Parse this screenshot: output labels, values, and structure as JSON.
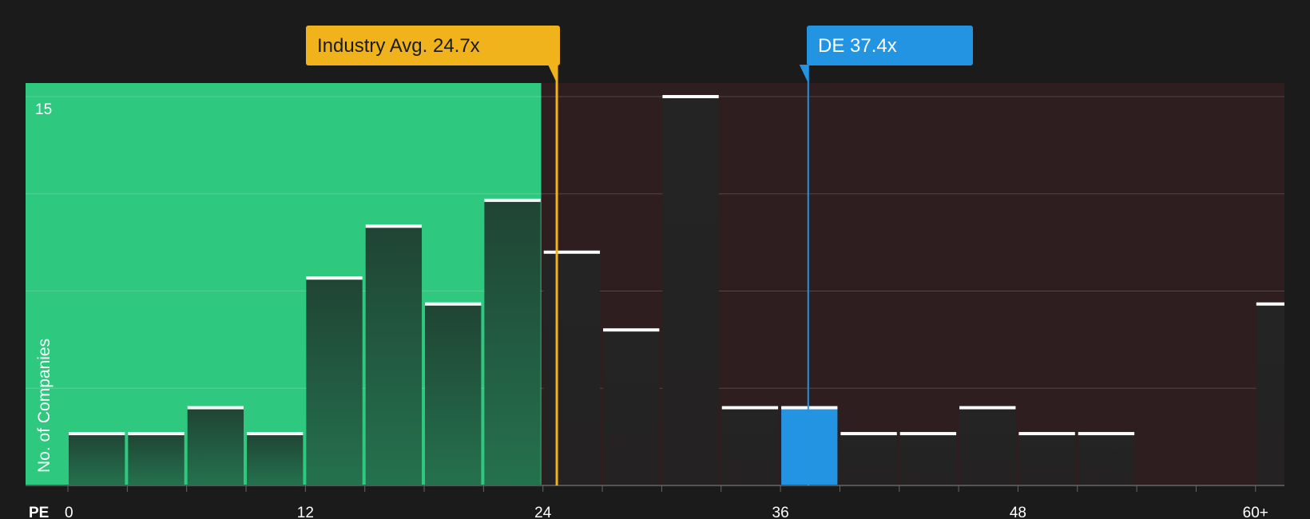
{
  "chart_data": {
    "type": "bar",
    "x_axis_label": "PE",
    "y_axis_label": "No. of Companies",
    "y_tick_label": "15",
    "x_ticks": [
      "0",
      "12",
      "24",
      "36",
      "48",
      "60+"
    ],
    "bin_width": 3,
    "ylim": [
      0,
      15
    ],
    "bars": [
      {
        "x_start": 0,
        "value": 2,
        "region": "below"
      },
      {
        "x_start": 3,
        "value": 2,
        "region": "below"
      },
      {
        "x_start": 6,
        "value": 3,
        "region": "below"
      },
      {
        "x_start": 9,
        "value": 2,
        "region": "below"
      },
      {
        "x_start": 12,
        "value": 8,
        "region": "below"
      },
      {
        "x_start": 15,
        "value": 10,
        "region": "below"
      },
      {
        "x_start": 18,
        "value": 7,
        "region": "below"
      },
      {
        "x_start": 21,
        "value": 11,
        "region": "below"
      },
      {
        "x_start": 24,
        "value": 9,
        "region": "above"
      },
      {
        "x_start": 27,
        "value": 6,
        "region": "above"
      },
      {
        "x_start": 30,
        "value": 15,
        "region": "above"
      },
      {
        "x_start": 33,
        "value": 3,
        "region": "above"
      },
      {
        "x_start": 36,
        "value": 3,
        "region": "highlight"
      },
      {
        "x_start": 39,
        "value": 2,
        "region": "above"
      },
      {
        "x_start": 42,
        "value": 2,
        "region": "above"
      },
      {
        "x_start": 45,
        "value": 3,
        "region": "above"
      },
      {
        "x_start": 48,
        "value": 2,
        "region": "above"
      },
      {
        "x_start": 51,
        "value": 2,
        "region": "above"
      },
      {
        "x_start": 60,
        "value": 7,
        "region": "above"
      }
    ],
    "markers": [
      {
        "label": "Industry Avg. 24.7x",
        "value": 24.7,
        "color": "#f0b31b",
        "text_color": "#1b1b1b"
      },
      {
        "label": "DE 37.4x",
        "value": 37.4,
        "color": "#2394e1",
        "text_color": "#ffffff"
      }
    ],
    "colors": {
      "background": "#1b1b1b",
      "below_region": "#2ec97f",
      "above_region": "#2e1e1f",
      "highlight_bar": "#2394e1",
      "bar_cap": "#ffffff"
    }
  }
}
